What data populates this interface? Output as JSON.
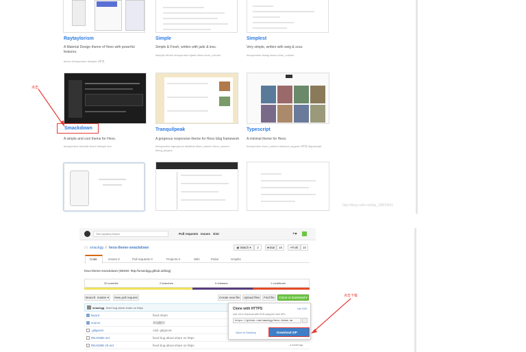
{
  "themes_top": [
    {
      "name": "Raytaylorism",
      "desc": "A Material Design theme of Hexo with powerful features.",
      "tags": "#hexo #responsive #simple #中文"
    },
    {
      "name": "Simple",
      "desc": "Simple & Fresh, written with jade & less.",
      "tags": "#simple #fresh #responsive #jade #less #one_column"
    },
    {
      "name": "Simplest",
      "desc": "Very simple, written with swig & scss.",
      "tags": "#responsive #swig #scss #one_column"
    }
  ],
  "themes_mid": [
    {
      "name": "Smackdown",
      "desc": "A simple and cool theme for Hexo.",
      "tags": "#responsive #mobile #cool #simple #cn"
    },
    {
      "name": "Tranquilpeak",
      "desc": "A gorgeous responsive theme for Hexo blog framework",
      "tags": "#responsive #gorgeous #sidebar #two_column #one_column #blog_plugins"
    },
    {
      "name": "Typescript",
      "desc": "A minimal theme for Hexo.",
      "tags": "#responsive #one_column #search_support #中文 #typescript"
    }
  ],
  "annotations": {
    "click_label": "点击",
    "download_label": "点击下载"
  },
  "watermark": "http://blog.csdn.net/qq_36803941",
  "github": {
    "search_placeholder": "This repository    Search",
    "nav": [
      "Pull requests",
      "Issues",
      "Gist"
    ],
    "owner": "smackgg",
    "repo": "hexo-theme-smackdown",
    "watch_label": "Watch",
    "watch_count": "2",
    "star_label": "Star",
    "star_count": "15",
    "fork_label": "Fork",
    "fork_count": "10",
    "tabs": [
      "Code",
      "Issues 0",
      "Pull requests 0",
      "Projects 0",
      "Wiki",
      "Pulse",
      "Graphs"
    ],
    "description": "hexo-theme-smackdown (DEMO: http://smackgg.github.io/blog)",
    "stats": [
      "29 commits",
      "2 branches",
      "0 releases",
      "1 contributor"
    ],
    "branch_label": "Branch: master ▾",
    "new_pr_label": "New pull request",
    "create_file": "Create new file",
    "upload_files": "Upload files",
    "find_file": "Find file",
    "clone_btn": "Clone or download ▾",
    "commit_author": "smackgg",
    "commit_msg": "fixed bug about share on https",
    "files": [
      {
        "name": "layout",
        "msg": "fixed share",
        "type": "dir"
      },
      {
        "name": "source",
        "msg": "添加翻页",
        "type": "dir"
      },
      {
        "name": ".gitignore",
        "msg": "Add .gitignore",
        "type": "file"
      },
      {
        "name": "README.md",
        "msg": "fixed bug about share on https",
        "type": "file"
      },
      {
        "name": "README.zh.md",
        "msg": "fixed bug about share on https",
        "type": "file"
      }
    ],
    "file_age": "a month ago",
    "clone_popup": {
      "title": "Clone with HTTPS",
      "use_ssh": "Use SSH",
      "help": "Use Git or checkout with SVN using the web URL.",
      "url": "https://github.com/smackgg/hexo-theme-sm",
      "open_desktop": "Open in Desktop",
      "download_zip": "Download ZIP"
    }
  }
}
